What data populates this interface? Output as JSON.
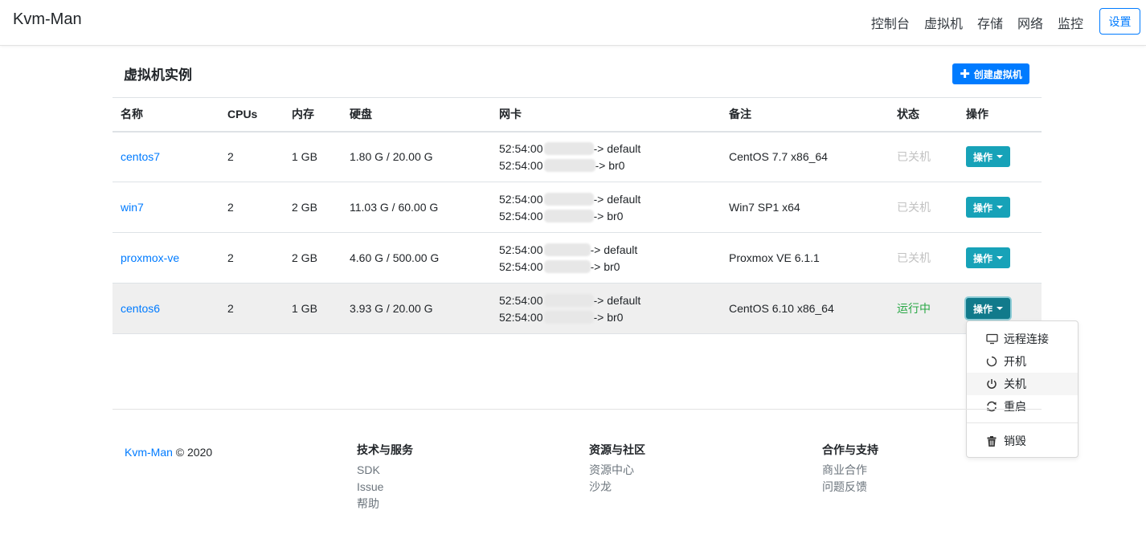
{
  "navbar": {
    "brand": "Kvm-Man",
    "links": [
      "控制台",
      "虚拟机",
      "存储",
      "网络",
      "监控"
    ],
    "settings": "设置"
  },
  "page": {
    "title": "虚拟机实例",
    "create_button": "创建虚拟机"
  },
  "table": {
    "headers": [
      "名称",
      "CPUs",
      "内存",
      "硬盘",
      "网卡",
      "备注",
      "状态",
      "操作"
    ],
    "rows": [
      {
        "name": "centos7",
        "cpus": "2",
        "memory": "1 GB",
        "disk": "1.80 G / 20.00 G",
        "nic1_prefix": "52:54:00",
        "nic1_net": "-> default",
        "nic2_prefix": "52:54:00",
        "nic2_net": " -> br0",
        "note": "CentOS 7.7 x86_64",
        "status": "已关机",
        "action": "操作"
      },
      {
        "name": "win7",
        "cpus": "2",
        "memory": "2 GB",
        "disk": "11.03 G / 60.00 G",
        "nic1_prefix": "52:54:00",
        "nic1_net": " -> default",
        "nic2_prefix": "52:54:00",
        "nic2_net": " -> br0",
        "note": "Win7 SP1 x64",
        "status": "已关机",
        "action": "操作"
      },
      {
        "name": "proxmox-ve",
        "cpus": "2",
        "memory": "2 GB",
        "disk": "4.60 G / 500.00 G",
        "nic1_prefix": "52:54:00",
        "nic1_net": "-> default",
        "nic2_prefix": "52:54:00",
        "nic2_net": " -> br0",
        "note": "Proxmox VE 6.1.1",
        "status": "已关机",
        "action": "操作"
      },
      {
        "name": "centos6",
        "cpus": "2",
        "memory": "1 GB",
        "disk": "3.93 G / 20.00 G",
        "nic1_prefix": "52:54:00",
        "nic1_net": " -> default",
        "nic2_prefix": "52:54:00",
        "nic2_net": " -> br0",
        "note": "CentOS 6.10 x86_64",
        "status": "运行中",
        "action": "操作"
      }
    ]
  },
  "dropdown": {
    "items": [
      {
        "label": "远程连接",
        "icon": "monitor-icon"
      },
      {
        "label": "开机",
        "icon": "power-on-icon"
      },
      {
        "label": "关机",
        "icon": "power-off-icon"
      },
      {
        "label": "重启",
        "icon": "refresh-icon"
      },
      {
        "label": "销毁",
        "icon": "trash-icon"
      }
    ]
  },
  "footer": {
    "brand": "Kvm-Man",
    "copyright": " © 2020",
    "columns": [
      {
        "title": "技术与服务",
        "links": [
          "SDK",
          "Issue",
          "帮助"
        ]
      },
      {
        "title": "资源与社区",
        "links": [
          "资源中心",
          "沙龙"
        ]
      },
      {
        "title": "合作与支持",
        "links": [
          "商业合作",
          "问题反馈"
        ]
      }
    ]
  },
  "colors": {
    "primary": "#007bff",
    "info": "#17a2b8",
    "running": "#28a745",
    "stopped": "#c2c2c2"
  }
}
